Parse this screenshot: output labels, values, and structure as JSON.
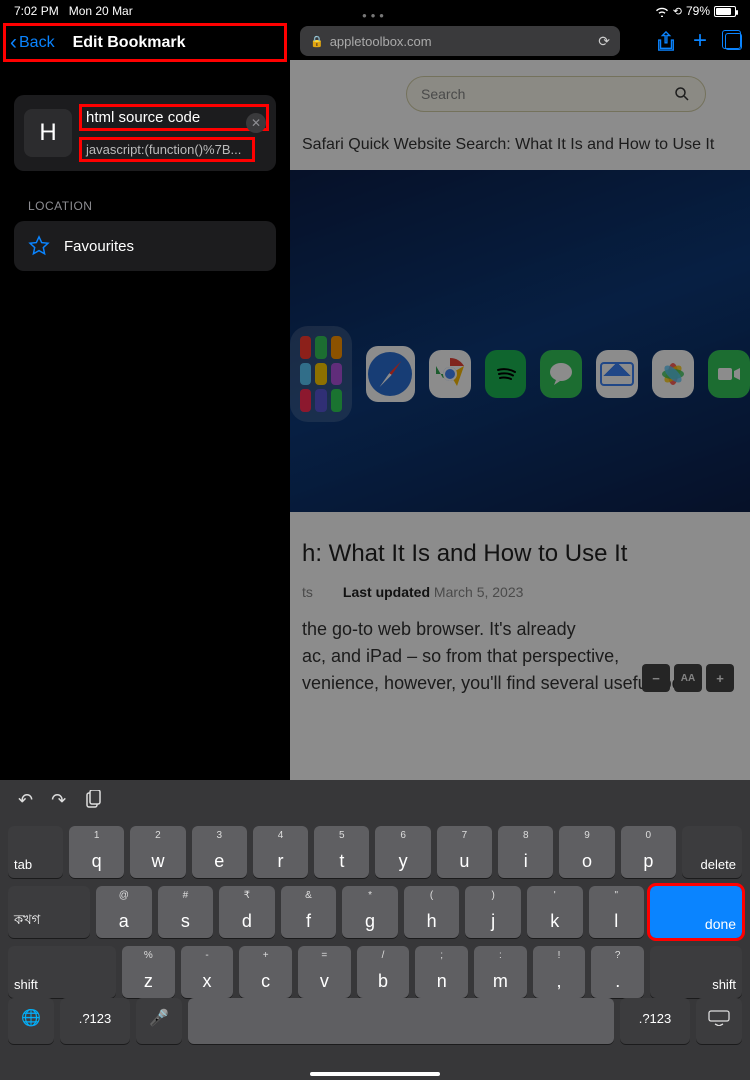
{
  "status": {
    "time": "7:02 PM",
    "date": "Mon 20 Mar",
    "battery_percent": "79%"
  },
  "topnav": {
    "url_domain": "appletoolbox.com",
    "actions": {
      "share": "Share",
      "add": "New tab",
      "tabs": "Tabs"
    }
  },
  "panel": {
    "back_label": "Back",
    "title": "Edit Bookmark",
    "bookmark_initial": "H",
    "bookmark_name": "html source code",
    "bookmark_url": "javascript:(function()%7B...",
    "location_section": "LOCATION",
    "location_value": "Favourites"
  },
  "page": {
    "search_placeholder": "Search",
    "breadcrumb_title": "Safari Quick Website Search: What It Is and How to Use It",
    "article_title_fragment": "h: What It Is and How to Use It",
    "meta_author_role": "ts",
    "meta_updated_label": "Last updated",
    "meta_updated_value": "March 5, 2023",
    "body_line1": "the go-to web browser. It's already",
    "body_line2": "ac, and iPad – so from that perspective,",
    "body_line3": "venience, however, you'll find several useful tools",
    "font_controls": {
      "minus": "−",
      "aa": "AA",
      "plus": "+"
    }
  },
  "keyboard": {
    "row1_alts": [
      "1",
      "2",
      "3",
      "4",
      "5",
      "6",
      "7",
      "8",
      "9",
      "0"
    ],
    "row1": [
      "q",
      "w",
      "e",
      "r",
      "t",
      "y",
      "u",
      "i",
      "o",
      "p"
    ],
    "row2_alts": [
      "@",
      "#",
      "₹",
      "&",
      "*",
      "(",
      ")",
      "'",
      "\""
    ],
    "row2": [
      "a",
      "s",
      "d",
      "f",
      "g",
      "h",
      "j",
      "k",
      "l"
    ],
    "row3_alts": [
      "%",
      "-",
      "+",
      "=",
      "/",
      ";",
      ":",
      "!",
      "?"
    ],
    "row3": [
      "z",
      "x",
      "c",
      "v",
      "b",
      "n",
      "m",
      ",",
      "."
    ],
    "tab": "tab",
    "lang": "কখগ",
    "delete": "delete",
    "done": "done",
    "shift": "shift",
    "numkey": ".?123"
  }
}
